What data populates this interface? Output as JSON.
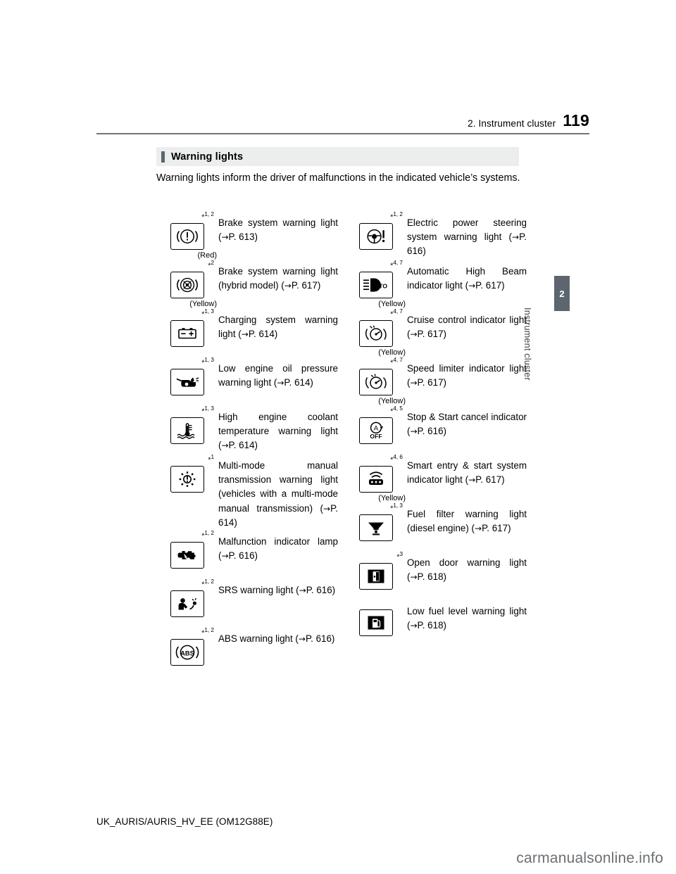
{
  "header": {
    "section": "2. Instrument cluster",
    "page_number": "119"
  },
  "margin_tab": {
    "number": "2",
    "label": "Instrument cluster"
  },
  "section": {
    "title": "Warning lights"
  },
  "intro": "Warning lights inform the driver of malfunctions in the indicated vehicle’s systems.",
  "footer": "UK_AURIS/AURIS_HV_EE (OM12G88E)",
  "watermark": "carmanualsonline.info",
  "left_column": [
    {
      "note": "*1, 2",
      "sub": "(Red)",
      "icon": "brake-system-warning-icon",
      "desc": "Brake system warning light (→P. 613)"
    },
    {
      "note": "*2",
      "sub": "(Yellow)",
      "icon": "brake-system-warning-hybrid-icon",
      "desc": "Brake system warning light (hybrid model) (→P. 617)"
    },
    {
      "note": "*1, 3",
      "sub": "",
      "icon": "charging-system-warning-icon",
      "desc": "Charging system warning light (→P. 614)"
    },
    {
      "note": "*1, 3",
      "sub": "",
      "icon": "low-engine-oil-pressure-icon",
      "desc": "Low engine oil pressure warning light (→P. 614)"
    },
    {
      "note": "*1, 3",
      "sub": "",
      "icon": "high-engine-coolant-temperature-icon",
      "desc": "High engine coolant temperature warning light (→P. 614)"
    },
    {
      "note": "*1",
      "sub": "",
      "icon": "multi-mode-manual-transmission-warning-icon",
      "desc": "Multi-mode manual transmission warning light (vehicles with a multi-mode manual transmission) (→P. 614)"
    },
    {
      "note": "*1, 2",
      "sub": "",
      "icon": "malfunction-indicator-lamp-icon",
      "desc": "Malfunction indicator lamp (→P. 616)"
    },
    {
      "note": "*1, 2",
      "sub": "",
      "icon": "srs-warning-icon",
      "desc": "SRS warning light (→P. 616)"
    },
    {
      "note": "*1, 2",
      "sub": "",
      "icon": "abs-warning-icon",
      "desc": "ABS warning light (→P. 616)"
    }
  ],
  "right_column": [
    {
      "note": "*1, 2",
      "sub": "",
      "icon": "electric-power-steering-warning-icon",
      "desc": "Electric power steering system warning light (→P. 616)"
    },
    {
      "note": "*4, 7",
      "sub": "(Yellow)",
      "icon": "automatic-high-beam-icon",
      "desc": "Automatic High Beam indicator light (→P. 617)"
    },
    {
      "note": "*4, 7",
      "sub": "(Yellow)",
      "icon": "cruise-control-indicator-icon",
      "desc": "Cruise control indicator light (→P. 617)"
    },
    {
      "note": "*4, 7",
      "sub": "(Yellow)",
      "icon": "speed-limiter-indicator-icon",
      "desc": "Speed limiter indicator light (→P. 617)"
    },
    {
      "note": "*4, 5",
      "sub": "",
      "icon": "stop-start-cancel-indicator-icon",
      "desc": "Stop & Start cancel indicator (→P. 616)"
    },
    {
      "note": "*4, 6",
      "sub": "(Yellow)",
      "icon": "smart-entry-start-system-indicator-icon",
      "desc": "Smart entry & start system indicator light (→P. 617)"
    },
    {
      "note": "*1, 3",
      "sub": "",
      "icon": "fuel-filter-warning-icon",
      "desc": "Fuel filter warning light (diesel engine) (→P. 617)"
    },
    {
      "note": "*3",
      "sub": "",
      "icon": "open-door-warning-icon",
      "desc": "Open door warning light (→P. 618)"
    },
    {
      "note": "",
      "sub": "",
      "icon": "low-fuel-level-warning-icon",
      "desc": "Low fuel level warning light (→P. 618)"
    }
  ]
}
